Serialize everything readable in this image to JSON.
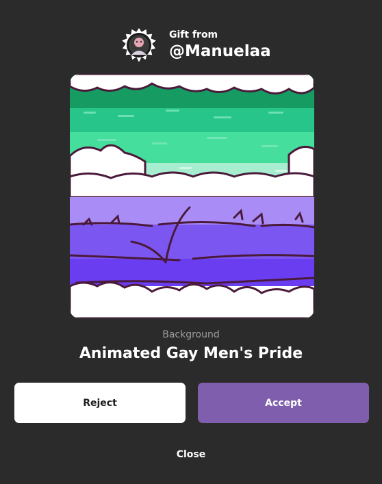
{
  "header": {
    "gift_label": "Gift from",
    "username": "@Manuelaa"
  },
  "item": {
    "category": "Background",
    "name": "Animated Gay Men's Pride",
    "colors": [
      "#2a9d6a",
      "#3fd49c",
      "#8de7c3",
      "#ffffff",
      "#a98cf5",
      "#7c56f0",
      "#6a3df0"
    ]
  },
  "actions": {
    "reject_label": "Reject",
    "accept_label": "Accept",
    "close_label": "Close"
  },
  "theme": {
    "background": "#2b2b2b",
    "accept_color": "#7f5fad",
    "reject_color": "#ffffff"
  }
}
